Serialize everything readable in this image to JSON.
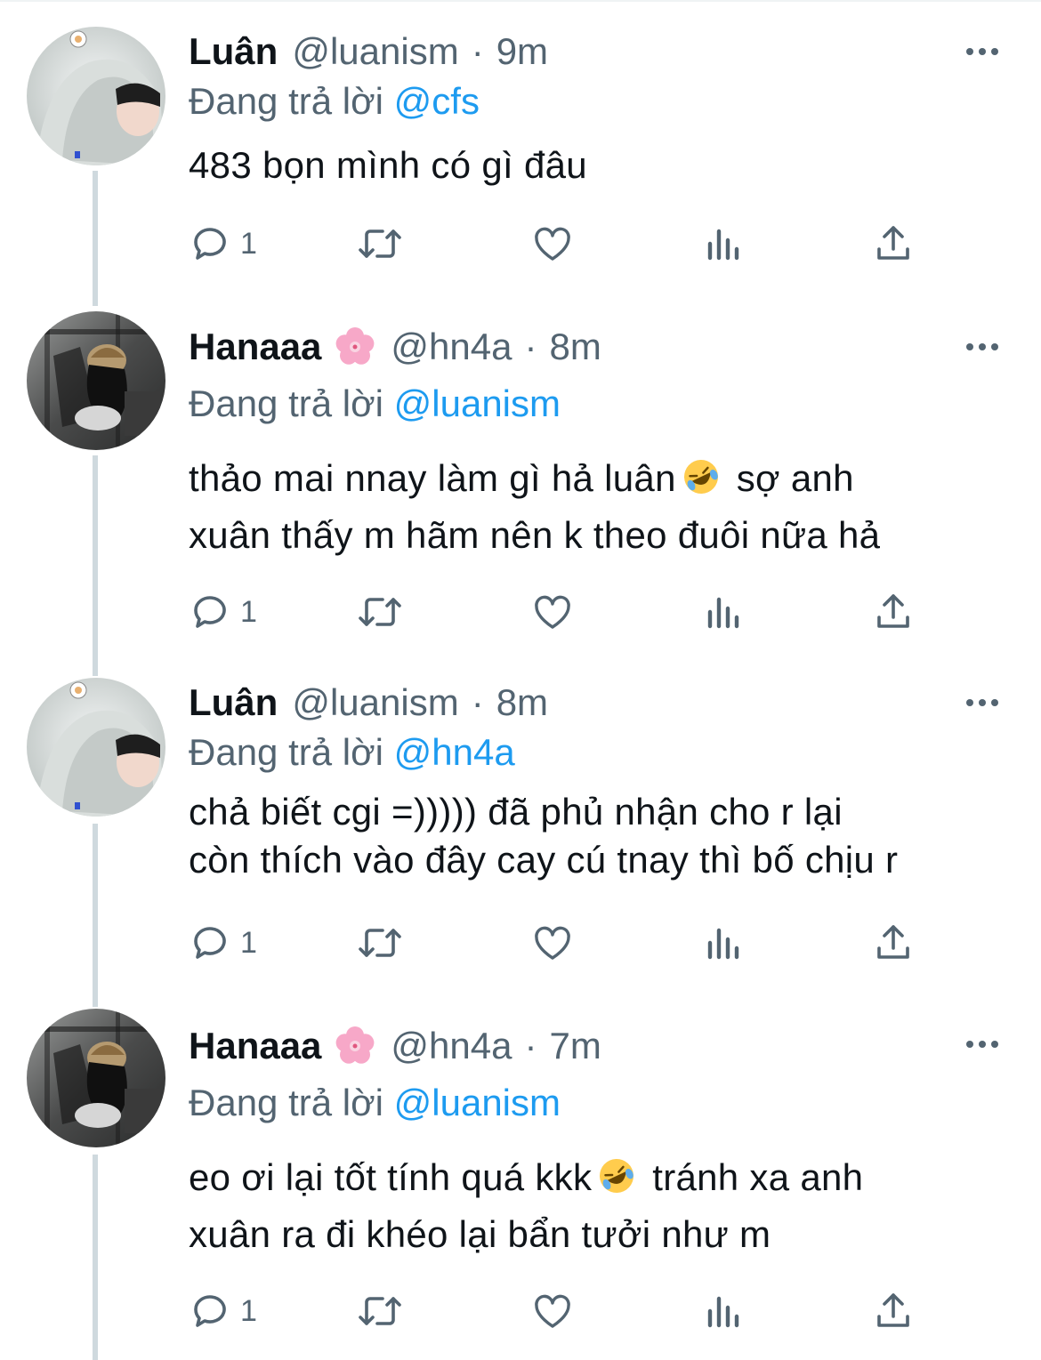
{
  "reply_prefix": "Đang trả lời",
  "tweets": [
    {
      "name": "Luân",
      "handle": "@luanism",
      "sep": "·",
      "time": "9m",
      "reply_to": "@cfs",
      "text_lines": [
        "483 bọn mình có gì đâu"
      ],
      "reply_count": "1",
      "avatar": "hoodie-avatar"
    },
    {
      "name": "Hanaaa",
      "handle": "@hn4a",
      "sep": "·",
      "time": "8m",
      "reply_to": "@luanism",
      "text_line1_a": "thảo mai nnay làm gì hả luân",
      "text_line1_b": "sợ anh",
      "text_line2": "xuân thấy m hãm nên k theo đuôi nữa hả",
      "reply_count": "1",
      "avatar": "dark-photo-avatar"
    },
    {
      "name": "Luân",
      "handle": "@luanism",
      "sep": "·",
      "time": "8m",
      "reply_to": "@hn4a",
      "text_lines": [
        "chả biết cgi =))))) đã phủ nhận cho r lại",
        "còn thích vào đây cay cú tnay thì bố chịu r"
      ],
      "reply_count": "1",
      "avatar": "hoodie-avatar"
    },
    {
      "name": "Hanaaa",
      "handle": "@hn4a",
      "sep": "·",
      "time": "7m",
      "reply_to": "@luanism",
      "text_line1_a": "eo ơi lại tốt tính quá kkk",
      "text_line1_b": "tránh xa anh",
      "text_line2": "xuân ra đi khéo lại bẩn tưởi như m",
      "reply_count": "1",
      "avatar": "dark-photo-avatar"
    }
  ],
  "colors": {
    "text": "#0f1419",
    "secondary": "#536471",
    "link": "#1d9bf0",
    "thread_line": "#cfd9de"
  },
  "icons": [
    "reply-icon",
    "retweet-icon",
    "like-icon",
    "views-icon",
    "share-icon",
    "more-icon",
    "cherry-blossom-icon",
    "rofl-emoji"
  ]
}
